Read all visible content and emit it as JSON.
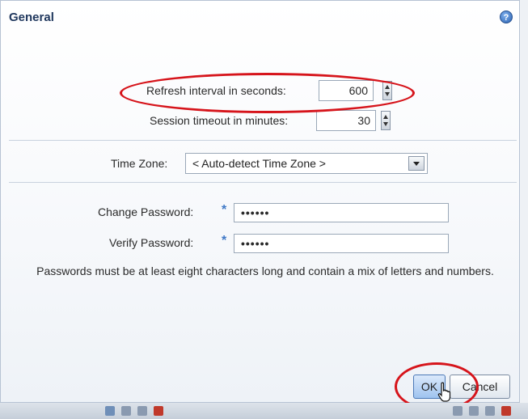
{
  "dialog": {
    "title": "General",
    "help_icon": "help-icon"
  },
  "refresh": {
    "label": "Refresh interval in seconds:",
    "value": "600"
  },
  "session": {
    "label": "Session timeout in minutes:",
    "value": "30"
  },
  "timezone": {
    "label": "Time Zone:",
    "selected": "< Auto-detect Time Zone >"
  },
  "password": {
    "change_label": "Change Password:",
    "change_value": "••••••",
    "verify_label": "Verify Password:",
    "verify_value": "••••••",
    "required_marker": "*",
    "note": "Passwords must be at least eight characters long and contain a mix of letters and numbers."
  },
  "buttons": {
    "ok": "OK",
    "cancel": "Cancel"
  },
  "colors": {
    "annotation": "#d6141b",
    "title": "#20385e",
    "required": "#3f78c6"
  }
}
